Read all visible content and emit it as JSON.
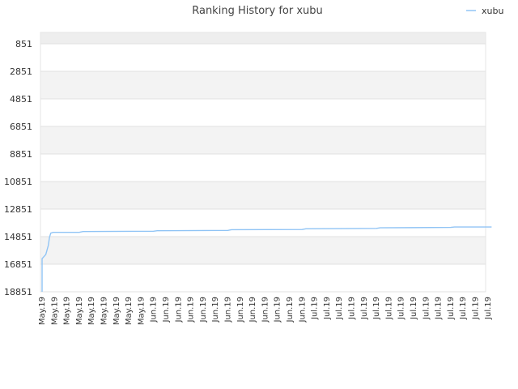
{
  "chart_data": {
    "type": "line",
    "title": "Ranking History for xubu",
    "xlabel": "",
    "ylabel": "",
    "y_inverted": true,
    "ylim": [
      851,
      18851
    ],
    "y_ticks": [
      851,
      2851,
      4851,
      6851,
      8851,
      10851,
      12851,
      14851,
      16851,
      18851
    ],
    "x_ticks": [
      "May.19",
      "May.19",
      "May.19",
      "May.19",
      "May.19",
      "May.19",
      "May.19",
      "May.19",
      "May.19",
      "Jun.19",
      "Jun.19",
      "Jun.19",
      "Jun.19",
      "Jun.19",
      "Jun.19",
      "Jun.19",
      "Jun.19",
      "Jun.19",
      "Jun.19",
      "Jun.19",
      "Jun.19",
      "Jun.19",
      "Jul.19",
      "Jul.19",
      "Jul.19",
      "Jul.19",
      "Jul.19",
      "Jul.19",
      "Jul.19",
      "Jul.19",
      "Jul.19",
      "Jul.19",
      "Jul.19",
      "Jul.19",
      "Jul.19",
      "Jul.19",
      "Jul.19"
    ],
    "grid": true,
    "legend_position": "top-right",
    "series": [
      {
        "name": "xubu",
        "color": "#90c4f5",
        "points": [
          [
            0.0,
            18851
          ],
          [
            0.0,
            16450
          ],
          [
            0.3,
            16150
          ],
          [
            0.5,
            15500
          ],
          [
            0.6,
            14900
          ],
          [
            0.7,
            14600
          ],
          [
            0.9,
            14540
          ],
          [
            3.0,
            14540
          ],
          [
            3.3,
            14480
          ],
          [
            9.0,
            14460
          ],
          [
            9.3,
            14420
          ],
          [
            15.0,
            14400
          ],
          [
            15.3,
            14350
          ],
          [
            21.0,
            14330
          ],
          [
            21.3,
            14280
          ],
          [
            27.0,
            14250
          ],
          [
            27.3,
            14210
          ],
          [
            33.0,
            14180
          ],
          [
            33.3,
            14150
          ],
          [
            36.3,
            14150
          ]
        ]
      }
    ]
  }
}
